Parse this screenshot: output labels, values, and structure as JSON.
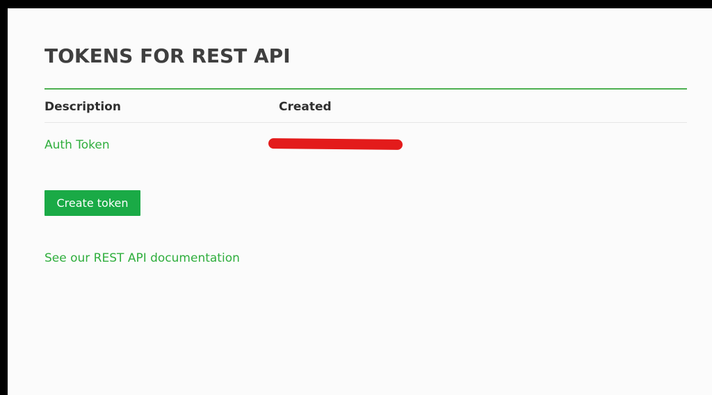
{
  "page": {
    "title": "TOKENS FOR REST API"
  },
  "table": {
    "headers": {
      "description": "Description",
      "created": "Created"
    },
    "rows": [
      {
        "description": "Auth Token",
        "created": ""
      }
    ]
  },
  "actions": {
    "create_token_label": "Create token",
    "docs_link_label": "See our REST API documentation"
  },
  "colors": {
    "accent_green": "#2fae3d",
    "button_green": "#1aaa46",
    "rule_green": "#4caf50",
    "redaction_red": "#e31b1b",
    "title_text": "#3f3f3f"
  }
}
